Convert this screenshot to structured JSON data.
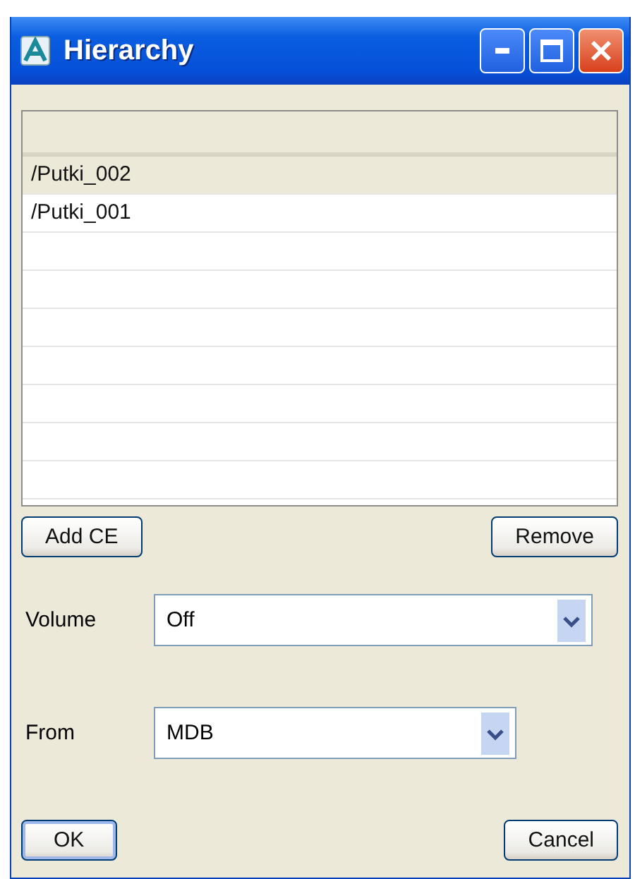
{
  "window": {
    "title": "Hierarchy"
  },
  "list": {
    "rows": [
      {
        "text": "/Putki_002",
        "selected": true
      },
      {
        "text": "/Putki_001",
        "selected": false
      }
    ]
  },
  "list_buttons": [
    {
      "label": "Add CE"
    },
    {
      "label": "Remove"
    }
  ],
  "fields": [
    {
      "label": "Volume",
      "value": "Off",
      "wide": true
    },
    {
      "label": "From",
      "value": "MDB",
      "wide": false
    }
  ],
  "buttons": [
    {
      "label": "OK",
      "default": true
    },
    {
      "label": "Cancel",
      "default": false
    }
  ]
}
